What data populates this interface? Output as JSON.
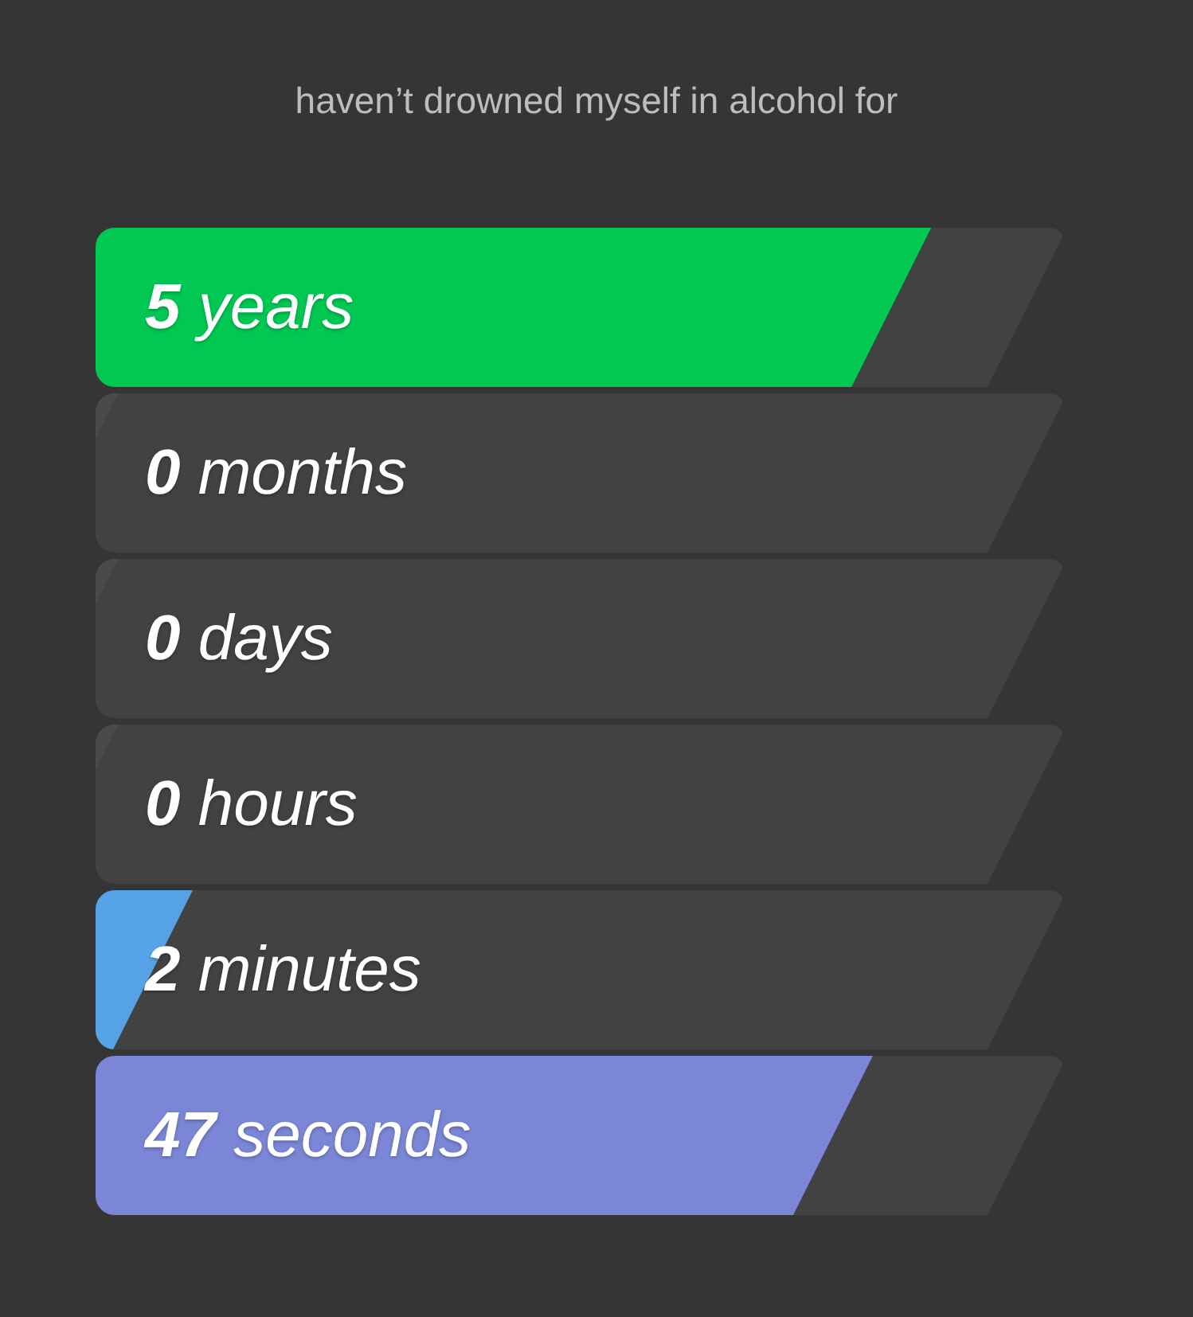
{
  "heading": "haven’t drowned myself in alcohol for",
  "rows": [
    {
      "label": "**5** years",
      "level": 0.86,
      "color": "#00c853"
    },
    {
      "label": "**0** months",
      "level": 0
    },
    {
      "label": "**0** days",
      "level": 0
    },
    {
      "label": "**0** hours",
      "level": 0
    },
    {
      "label": "**2** minutes",
      "level": 0.1,
      "color": "#56a3e8"
    },
    {
      "label": "**47** seconds",
      "level": 0.8,
      "color": "#7b87d6"
    }
  ]
}
